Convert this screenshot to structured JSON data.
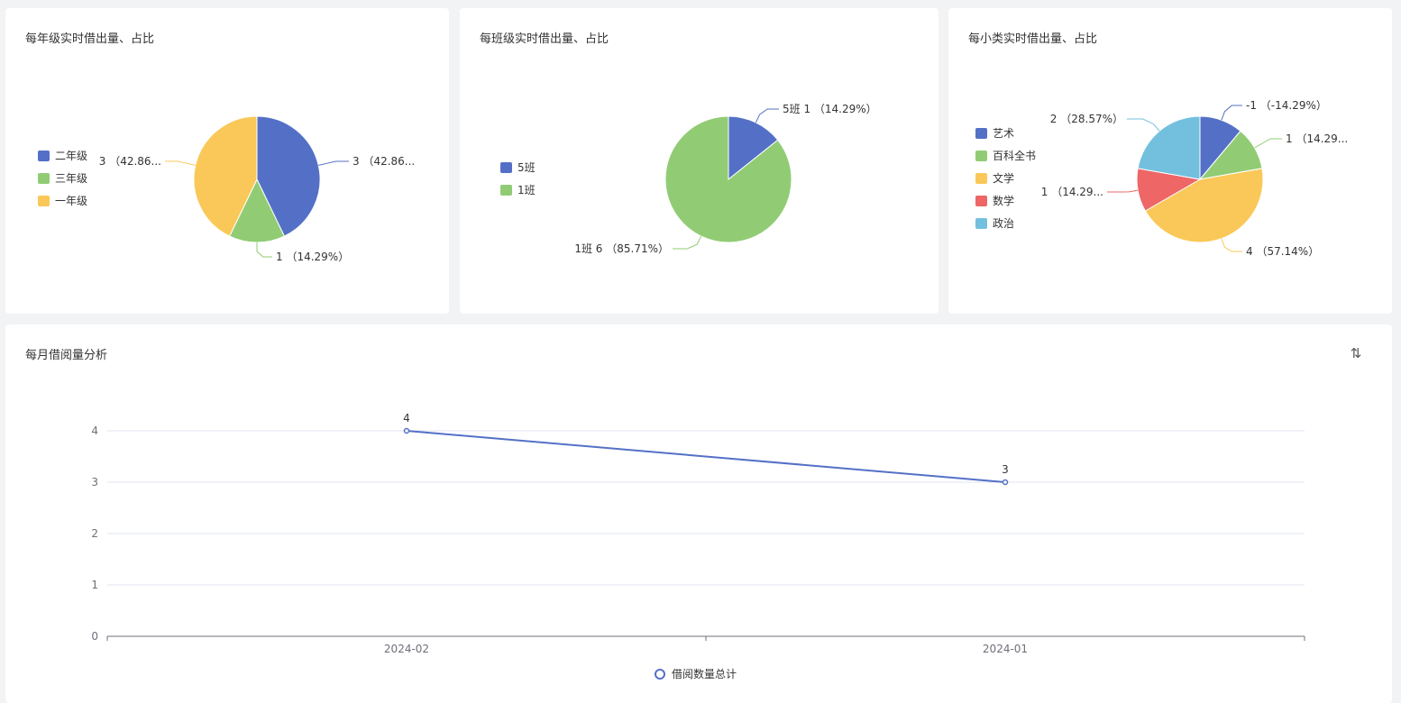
{
  "colors": {
    "blue": "#5470c6",
    "green": "#91cc75",
    "yellow": "#fac858",
    "red": "#ee6666",
    "cyan": "#73c0de"
  },
  "cards": {
    "grade": {
      "title": "每年级实时借出量、占比"
    },
    "class": {
      "title": "每班级实时借出量、占比"
    },
    "category": {
      "title": "每小类实时借出量、占比"
    },
    "monthly": {
      "title": "每月借阅量分析",
      "sort_icon": "sort-icon"
    }
  },
  "chart_data": [
    {
      "type": "pie",
      "legend": [
        "二年级",
        "三年级",
        "一年级"
      ],
      "slices": [
        {
          "name": "二年级",
          "value": 3,
          "percent": "42.86",
          "color": "#5470c6",
          "label": "3 （42.86..."
        },
        {
          "name": "三年级",
          "value": 1,
          "percent": "14.29",
          "color": "#91cc75",
          "label": "1 （14.29%）"
        },
        {
          "name": "一年级",
          "value": 3,
          "percent": "42.86",
          "color": "#fac858",
          "label": "3 （42.86..."
        }
      ]
    },
    {
      "type": "pie",
      "legend": [
        "5班",
        "1班"
      ],
      "slices": [
        {
          "name": "5班",
          "value": 1,
          "percent": "14.29",
          "color": "#5470c6",
          "label": "5班 1 （14.29%）"
        },
        {
          "name": "1班",
          "value": 6,
          "percent": "85.71",
          "color": "#91cc75",
          "label": "1班 6 （85.71%）"
        }
      ]
    },
    {
      "type": "pie",
      "legend": [
        "艺术",
        "百科全书",
        "文学",
        "数学",
        "政治"
      ],
      "slices": [
        {
          "name": "艺术",
          "value": -1,
          "percent": "-14.29",
          "color": "#5470c6",
          "label": "-1 （-14.29%）"
        },
        {
          "name": "百科全书",
          "value": 1,
          "percent": "14.29",
          "color": "#91cc75",
          "label": "1 （14.29..."
        },
        {
          "name": "文学",
          "value": 4,
          "percent": "57.14",
          "color": "#fac858",
          "label": "4 （57.14%）"
        },
        {
          "name": "数学",
          "value": 1,
          "percent": "14.29",
          "color": "#ee6666",
          "label": "1 （14.29..."
        },
        {
          "name": "政治",
          "value": 2,
          "percent": "28.57",
          "color": "#73c0de",
          "label": "2 （28.57%）"
        }
      ]
    },
    {
      "type": "line",
      "categories": [
        "2024-02",
        "2024-01"
      ],
      "series": [
        {
          "name": "借阅数量总计",
          "values": [
            4,
            3
          ],
          "color": "#5470c6"
        }
      ],
      "yticks": [
        0,
        1,
        2,
        3,
        4
      ],
      "ylim": [
        0,
        4
      ],
      "data_labels": true,
      "legend_position": "bottom"
    }
  ]
}
